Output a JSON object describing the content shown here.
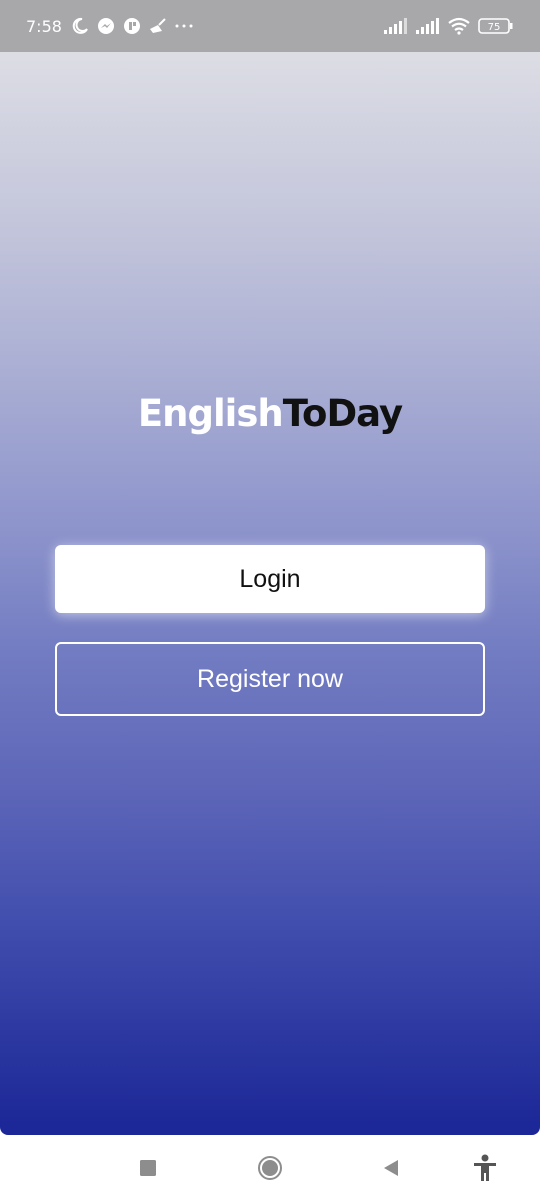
{
  "status_bar": {
    "time": "7:58",
    "left_icons": [
      "moon-icon",
      "messenger-icon",
      "app-notification-icon",
      "cleaner-icon",
      "more-dots-icon"
    ],
    "right_icons": [
      "signal-icon",
      "signal-icon",
      "wifi-icon",
      "battery-icon"
    ],
    "battery_level": "75"
  },
  "app": {
    "logo_part1": "English",
    "logo_part2": "ToDay",
    "login_label": "Login",
    "register_label": "Register now"
  },
  "nav_bar": {
    "icons": [
      "recent-apps-icon",
      "home-icon",
      "back-icon",
      "accessibility-icon"
    ]
  },
  "colors": {
    "gradient_top": "#dcdde4",
    "gradient_bottom": "#1b2697",
    "status_bar": "#a8a8ab"
  }
}
